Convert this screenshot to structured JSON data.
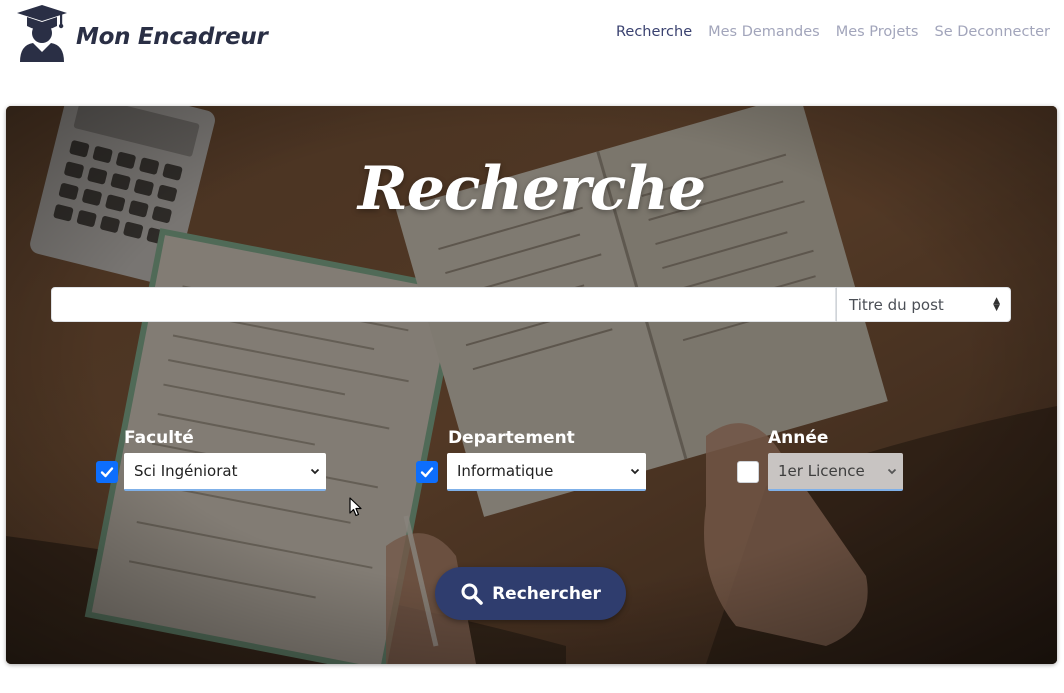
{
  "app": {
    "brand_name": "Mon Encadreur",
    "brand_color": "#2a2f45"
  },
  "nav": {
    "items": [
      {
        "label": "Recherche",
        "active": true
      },
      {
        "label": "Mes Demandes",
        "active": false
      },
      {
        "label": "Mes Projets",
        "active": false
      },
      {
        "label": "Se Deconnecter",
        "active": false
      }
    ],
    "active_color": "#3a4270",
    "inactive_color": "#a2a5bb"
  },
  "hero": {
    "title": "Recherche"
  },
  "search": {
    "query_value": "",
    "type_select": {
      "value": "Titre du post"
    }
  },
  "filters": [
    {
      "label": "Faculté",
      "checked": true,
      "selected": "Sci Ingéniorat",
      "disabled": false
    },
    {
      "label": "Departement",
      "checked": true,
      "selected": "Informatique",
      "disabled": false
    },
    {
      "label": "Année",
      "checked": false,
      "selected": "1er Licence",
      "disabled": true
    }
  ],
  "actions": {
    "search_button_label": "Rechercher",
    "search_button_color": "#2f3d6e"
  },
  "icons": {
    "logo": "graduate-logo-icon",
    "search_button": "magnifier-icon",
    "checkbox": "check-icon",
    "select": "chevron-down-icon",
    "type_select": "sort-arrows-icon",
    "pointer": "mouse-cursor-icon"
  },
  "colors": {
    "checkbox_checked": "#0d6efd"
  }
}
